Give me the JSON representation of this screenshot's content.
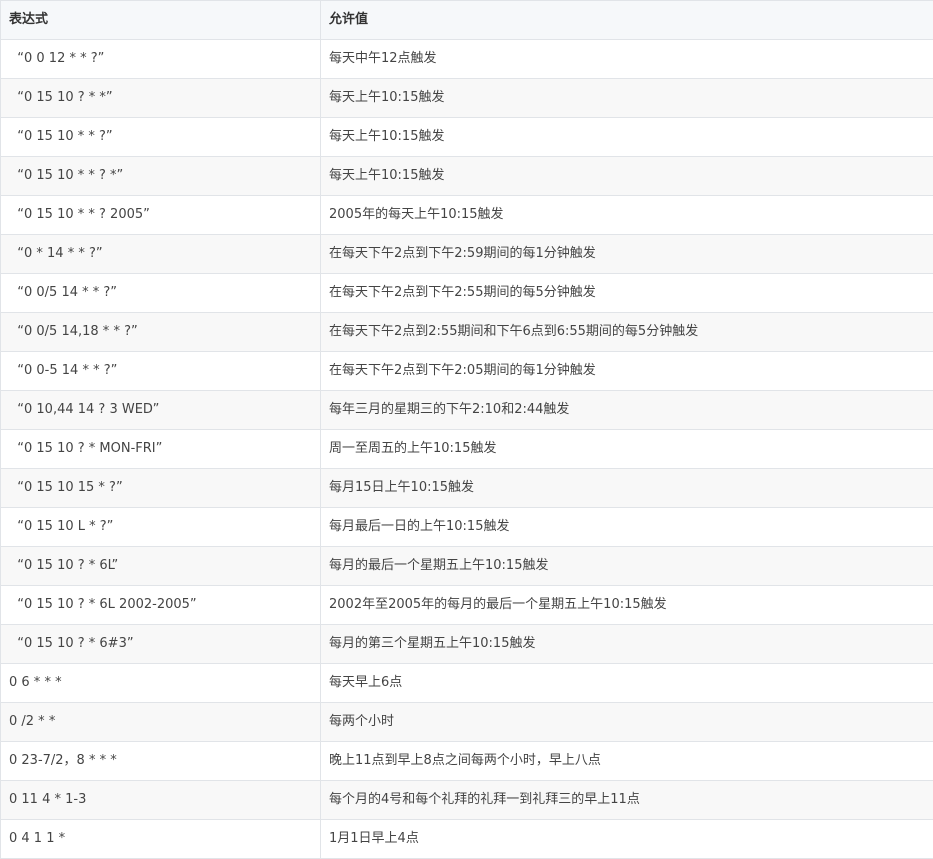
{
  "table": {
    "headers": [
      "表达式",
      "允许值"
    ],
    "rows": [
      {
        "expr": "  “0 0 12 * * ?”",
        "desc": "每天中午12点触发"
      },
      {
        "expr": "  “0 15 10 ? * *”",
        "desc": "每天上午10:15触发"
      },
      {
        "expr": "  “0 15 10 * * ?”",
        "desc": "每天上午10:15触发"
      },
      {
        "expr": "  “0 15 10 * * ? *”",
        "desc": "每天上午10:15触发"
      },
      {
        "expr": "  “0 15 10 * * ? 2005”",
        "desc": "2005年的每天上午10:15触发"
      },
      {
        "expr": "  “0 * 14 * * ?”",
        "desc": "在每天下午2点到下午2:59期间的每1分钟触发"
      },
      {
        "expr": "  “0 0/5 14 * * ?”",
        "desc": "在每天下午2点到下午2:55期间的每5分钟触发"
      },
      {
        "expr": "  “0 0/5 14,18 * * ?”",
        "desc": "在每天下午2点到2:55期间和下午6点到6:55期间的每5分钟触发"
      },
      {
        "expr": "  “0 0-5 14 * * ?”",
        "desc": "在每天下午2点到下午2:05期间的每1分钟触发"
      },
      {
        "expr": "  “0 10,44 14 ? 3 WED”",
        "desc": "每年三月的星期三的下午2:10和2:44触发"
      },
      {
        "expr": "  “0 15 10 ? * MON-FRI”",
        "desc": "周一至周五的上午10:15触发"
      },
      {
        "expr": "  “0 15 10 15 * ?”",
        "desc": "每月15日上午10:15触发"
      },
      {
        "expr": "  “0 15 10 L * ?”",
        "desc": "每月最后一日的上午10:15触发"
      },
      {
        "expr": "  “0 15 10 ? * 6L”",
        "desc": "每月的最后一个星期五上午10:15触发"
      },
      {
        "expr": "  “0 15 10 ? * 6L 2002-2005”",
        "desc": "2002年至2005年的每月的最后一个星期五上午10:15触发"
      },
      {
        "expr": "  “0 15 10 ? * 6#3”",
        "desc": "每月的第三个星期五上午10:15触发"
      },
      {
        "expr": "0 6 * * *",
        "desc": "每天早上6点"
      },
      {
        "expr": "0 /2 * *",
        "desc": "每两个小时"
      },
      {
        "expr": "0 23-7/2，8 * * *",
        "desc": "晚上11点到早上8点之间每两个小时，早上八点"
      },
      {
        "expr": "0 11 4 * 1-3",
        "desc": "每个月的4号和每个礼拜的礼拜一到礼拜三的早上11点"
      },
      {
        "expr": "0 4 1 1 *",
        "desc": "1月1日早上4点"
      }
    ]
  }
}
